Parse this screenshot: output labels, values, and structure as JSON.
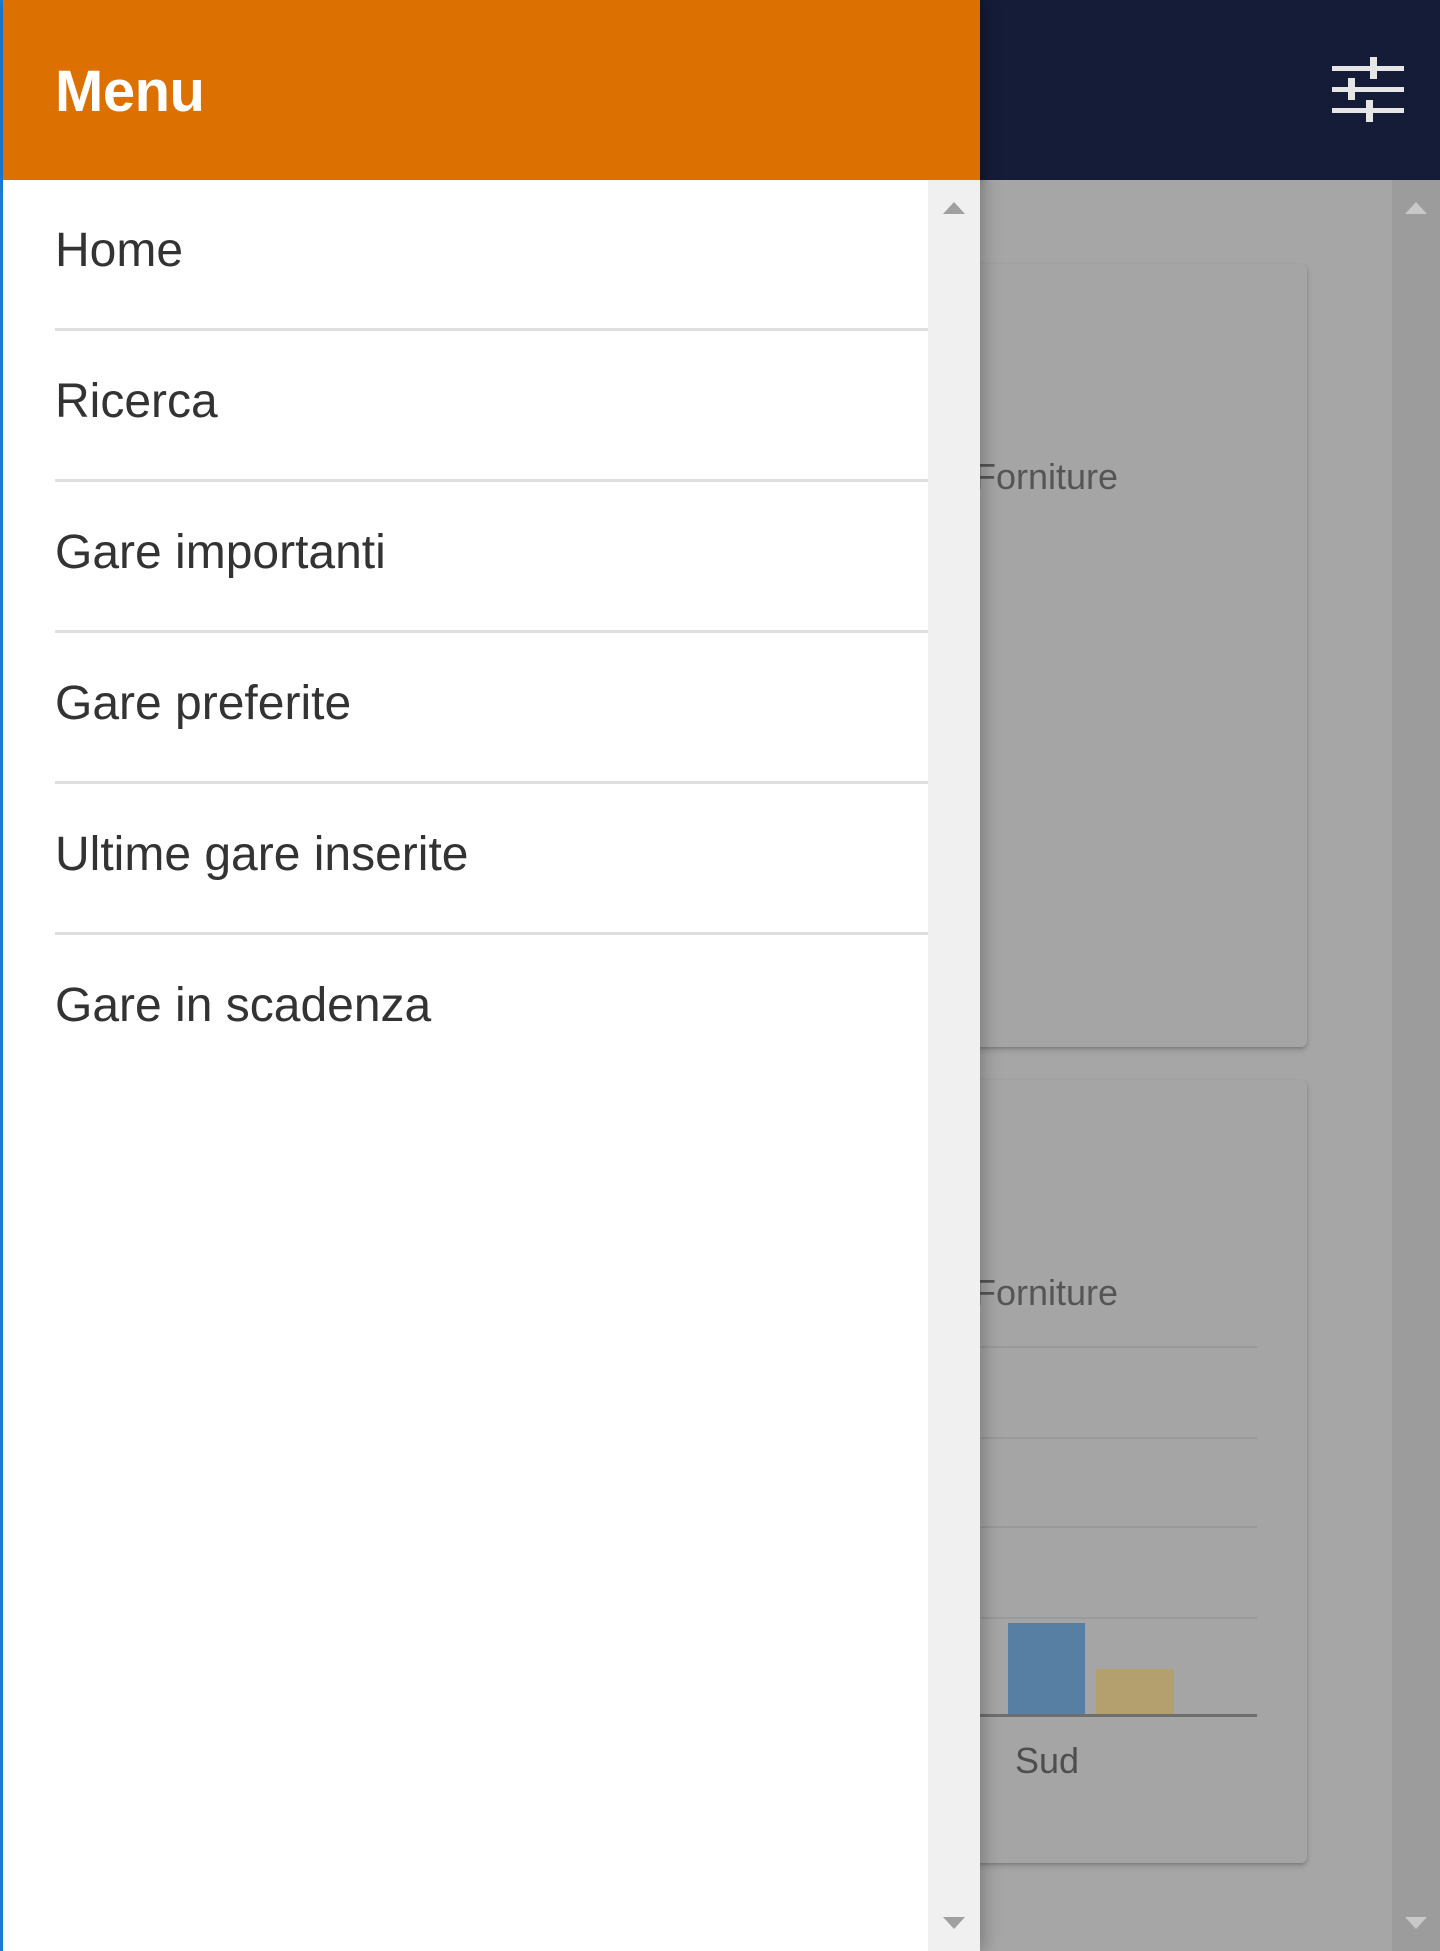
{
  "app": {
    "filter_icon": "sliders-icon",
    "cards": [
      {
        "label_fragment": "Forniture"
      },
      {
        "label_fragment": "Forniture",
        "chart_category": "Sud"
      }
    ]
  },
  "drawer": {
    "title": "Menu",
    "items": [
      {
        "label": "Home"
      },
      {
        "label": "Ricerca"
      },
      {
        "label": "Gare importanti"
      },
      {
        "label": "Gare preferite"
      },
      {
        "label": "Ultime gare inserite"
      },
      {
        "label": "Gare in scadenza"
      }
    ]
  },
  "colors": {
    "drawer_header": "#dc7000",
    "app_topbar": "#141c38",
    "bar_pink": "#c2778a",
    "bar_blue": "#577fa3",
    "bar_gold": "#b3a06e"
  }
}
